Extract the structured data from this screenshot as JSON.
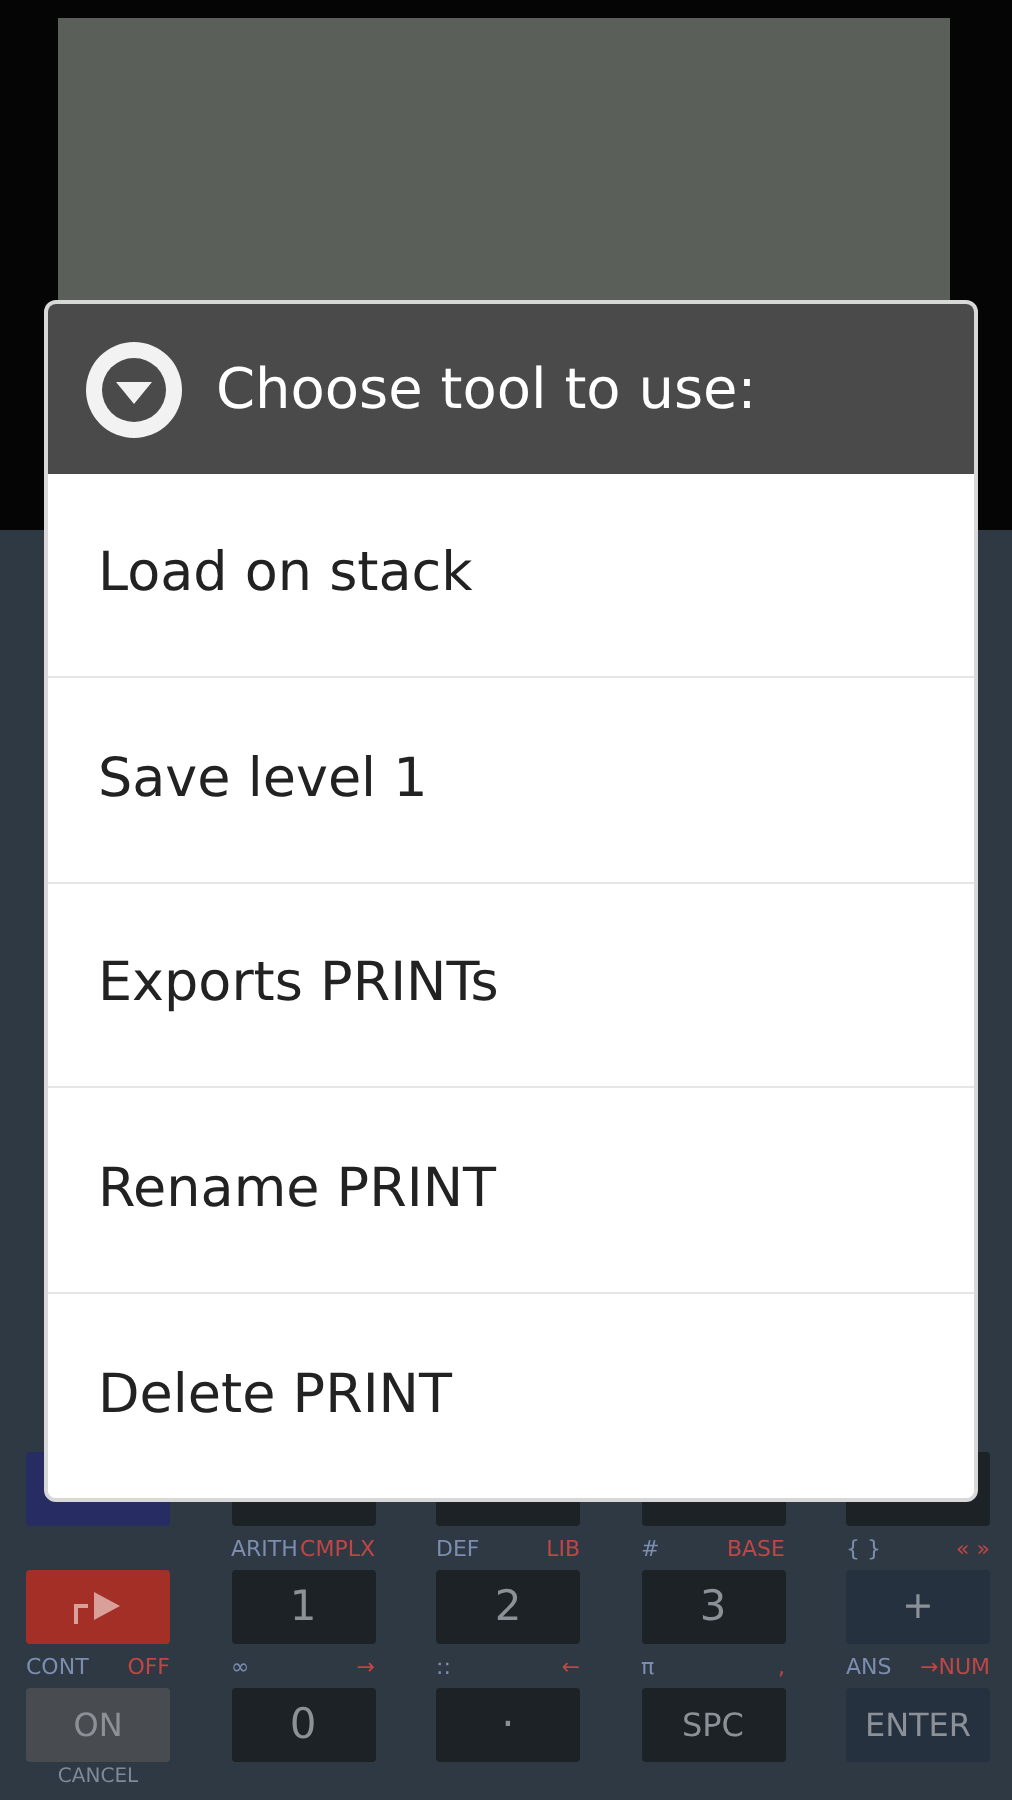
{
  "dialog": {
    "title": "Choose tool to use:",
    "items": [
      {
        "label": "Load on stack"
      },
      {
        "label": "Save level 1"
      },
      {
        "label": "Exports PRINTs"
      },
      {
        "label": "Rename PRINT"
      },
      {
        "label": "Delete PRINT"
      }
    ]
  },
  "keypad": {
    "rows": [
      {
        "keys": [
          {
            "kind": "alpha"
          },
          {
            "kind": "number"
          },
          {
            "kind": "number"
          },
          {
            "kind": "number"
          },
          {
            "kind": "number"
          }
        ]
      },
      {
        "keys": [
          {
            "kind": "shift"
          },
          {
            "kind": "number",
            "label": "1",
            "left": "ARITH",
            "right": "CMPLX"
          },
          {
            "kind": "number",
            "label": "2",
            "left": "DEF",
            "right": "LIB"
          },
          {
            "kind": "number",
            "label": "3",
            "left": "#",
            "right": "BASE"
          },
          {
            "kind": "op",
            "label": "+",
            "left": "{ }",
            "right": "« »"
          }
        ]
      },
      {
        "keys": [
          {
            "kind": "on",
            "label": "ON",
            "left": "CONT",
            "right": "OFF",
            "below": "CANCEL"
          },
          {
            "kind": "number",
            "label": "0",
            "left": "∞",
            "right": "→"
          },
          {
            "kind": "number",
            "label": "·",
            "left": "::",
            "right": "←"
          },
          {
            "kind": "number",
            "label": "SPC",
            "left": "π",
            "right": ","
          },
          {
            "kind": "op",
            "label": "ENTER",
            "left": "ANS",
            "right": "→NUM"
          }
        ]
      }
    ]
  }
}
